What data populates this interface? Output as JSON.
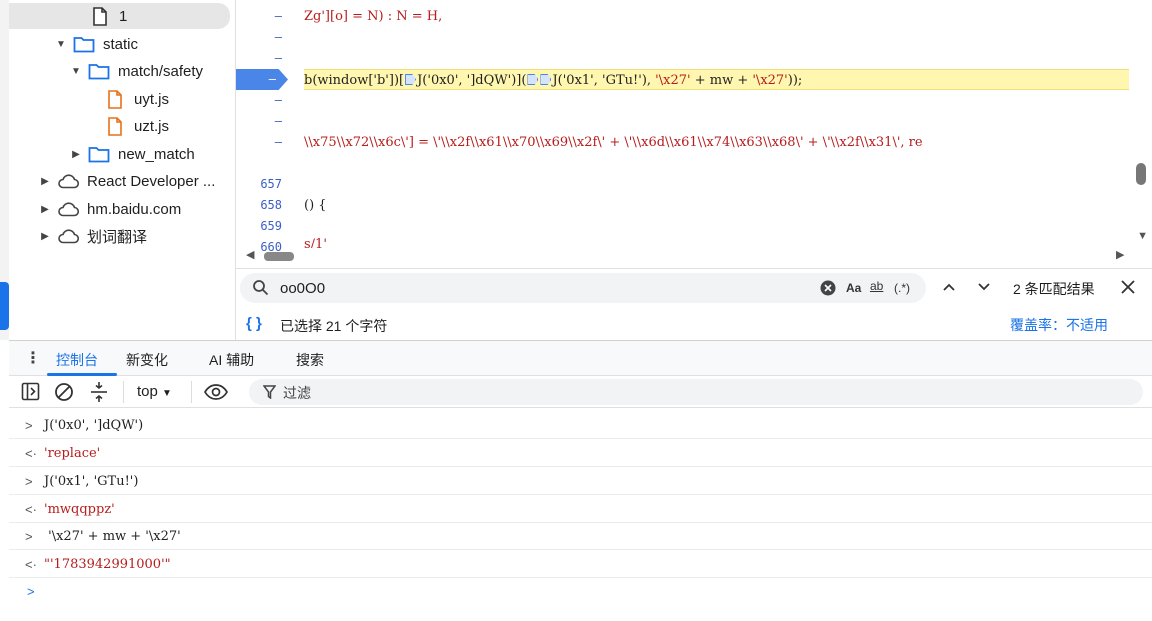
{
  "tree": {
    "items": [
      {
        "label": "1",
        "icon": "file-icon"
      },
      {
        "label": "static",
        "icon": "folder-icon"
      },
      {
        "label": "match/safety",
        "icon": "folder-icon"
      },
      {
        "label": "uyt.js",
        "icon": "js-file-icon"
      },
      {
        "label": "uzt.js",
        "icon": "js-file-icon"
      },
      {
        "label": "new_match",
        "icon": "folder-icon"
      },
      {
        "label": "React Developer ...",
        "icon": "cloud-icon"
      },
      {
        "label": "hm.baidu.com",
        "icon": "cloud-icon"
      },
      {
        "label": "划词翻译",
        "icon": "cloud-icon"
      }
    ]
  },
  "editor": {
    "gutter": [
      "–",
      "–",
      "–",
      "–",
      "–",
      "–",
      "–",
      "657",
      "658",
      "659",
      "660"
    ],
    "lines": {
      "l1": "Zg'][o] = N) : N = H,",
      "l4_pre": "b(window['b'])[",
      "l4_a": "J('0x0', ']dQW')",
      "l4_mid": "](",
      "l4_b": "J('0x1', 'GTu!'), ",
      "l4_c": "'\\x27'",
      "l4_d": " + mw + ",
      "l4_e": "'\\x27'",
      "l4_f": "));",
      "l7": "\\\\x75\\\\x72\\\\x6c\\'] = \\'\\\\x2f\\\\x61\\\\x70\\\\x69\\\\x2f\\' + \\'\\\\x6d\\\\x61\\\\x74\\\\x63\\\\x68\\' + \\'\\\\x2f\\\\x31\\', re",
      "l9": "() {",
      "l11": "s/1'"
    }
  },
  "search": {
    "query": "oo0O0",
    "case_label": "Aa",
    "word_label": "ab",
    "regex_label": "(.*)",
    "match_count": "2 条匹配结果"
  },
  "status": {
    "selection": "已选择 21 个字符",
    "coverage": "覆盖率：不适用"
  },
  "drawer": {
    "tabs": [
      "控制台",
      "新变化",
      "AI 辅助",
      "搜索"
    ]
  },
  "console_toolbar": {
    "context": "top",
    "filter_placeholder": "过滤"
  },
  "console": {
    "rows": [
      {
        "dir": "in",
        "text": "J('0x0', ']dQW')"
      },
      {
        "dir": "out",
        "text": "'replace'"
      },
      {
        "dir": "in",
        "text": "J('0x1', 'GTu!')"
      },
      {
        "dir": "out",
        "text": "'mwqqppz'"
      },
      {
        "dir": "in",
        "text": " '\\x27' + mw + '\\x27'"
      },
      {
        "dir": "out",
        "text": "\"'1783942991000'\""
      }
    ]
  }
}
